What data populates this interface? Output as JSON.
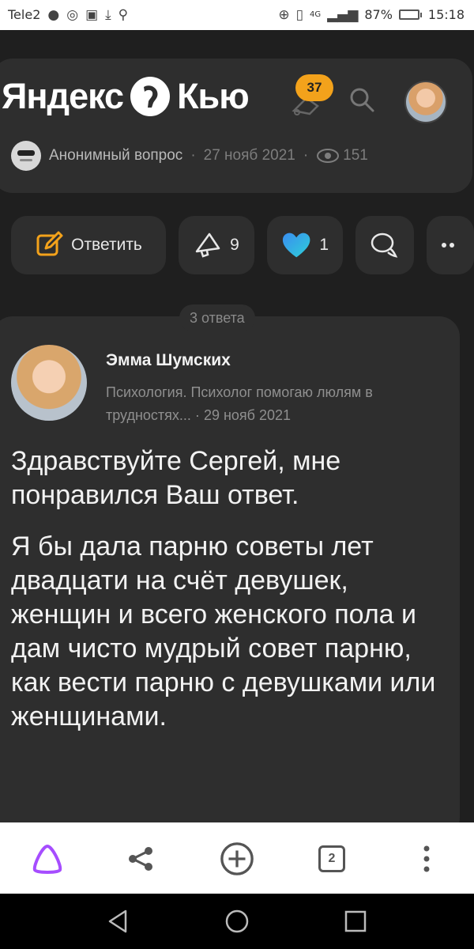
{
  "status_bar": {
    "carrier": "Tele2",
    "battery": "87%",
    "time": "15:18",
    "network": "4G",
    "battery_level": 0.87
  },
  "header": {
    "logo_text_left": "Яндекс",
    "logo_text_right": "Кью",
    "notifications_badge": "37"
  },
  "question_meta": {
    "author": "Анонимный вопрос",
    "separator": "·",
    "date": "27 нояб 2021",
    "views": "151"
  },
  "actions": {
    "reply_label": "Ответить",
    "reposts": "9",
    "likes": "1"
  },
  "answers": {
    "count_label": "3 ответа"
  },
  "answer": {
    "author_name": "Эмма Шумских",
    "author_desc": "Психология. Психолог помогаю люлям в трудностях...",
    "date": "29 нояб 2021",
    "paragraph1": "Здравствуйте Сергей, мне понравился Ваш ответ.",
    "paragraph2": "Я бы дала парню советы лет двадцати на счёт девушек, женщин и всего женского пола и дам чисто мудрый совет парню, как вести парню с девушками или женщинами."
  },
  "browser": {
    "tabs_count": "2"
  },
  "colors": {
    "accent_orange": "#f3a21b",
    "like_blue": "#2bb6e6",
    "alice_purple": "#a64dff",
    "card_bg": "#2e2e2e",
    "page_bg": "#1f1f1f"
  }
}
